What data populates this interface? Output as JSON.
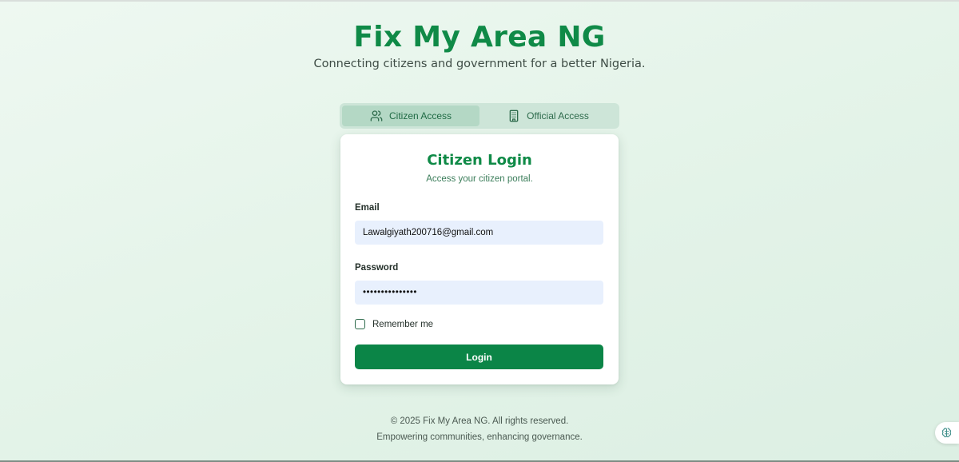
{
  "header": {
    "title": "Fix My Area NG",
    "subtitle": "Connecting citizens and government for a better Nigeria."
  },
  "tabs": [
    {
      "label": "Citizen Access",
      "icon": "users-icon",
      "active": true
    },
    {
      "label": "Official Access",
      "icon": "building-icon",
      "active": false
    }
  ],
  "login": {
    "title": "Citizen Login",
    "subtitle": "Access your citizen portal.",
    "email_label": "Email",
    "email_value": "Lawalgiyath200716@gmail.com",
    "password_label": "Password",
    "password_value": "•••••••••••••••",
    "remember_label": "Remember me",
    "remember_checked": false,
    "submit_label": "Login"
  },
  "footer": {
    "copyright": "© 2025 Fix My Area NG. All rights reserved.",
    "tagline": "Empowering communities, enhancing governance."
  },
  "colors": {
    "brand_green": "#0f8a47",
    "button_green": "#0b8547",
    "input_bg": "#e8f0fd",
    "tabs_bg": "#cde5d8",
    "tab_active_bg": "#b4d8c5"
  },
  "widget": {
    "icon": "brain-icon"
  }
}
